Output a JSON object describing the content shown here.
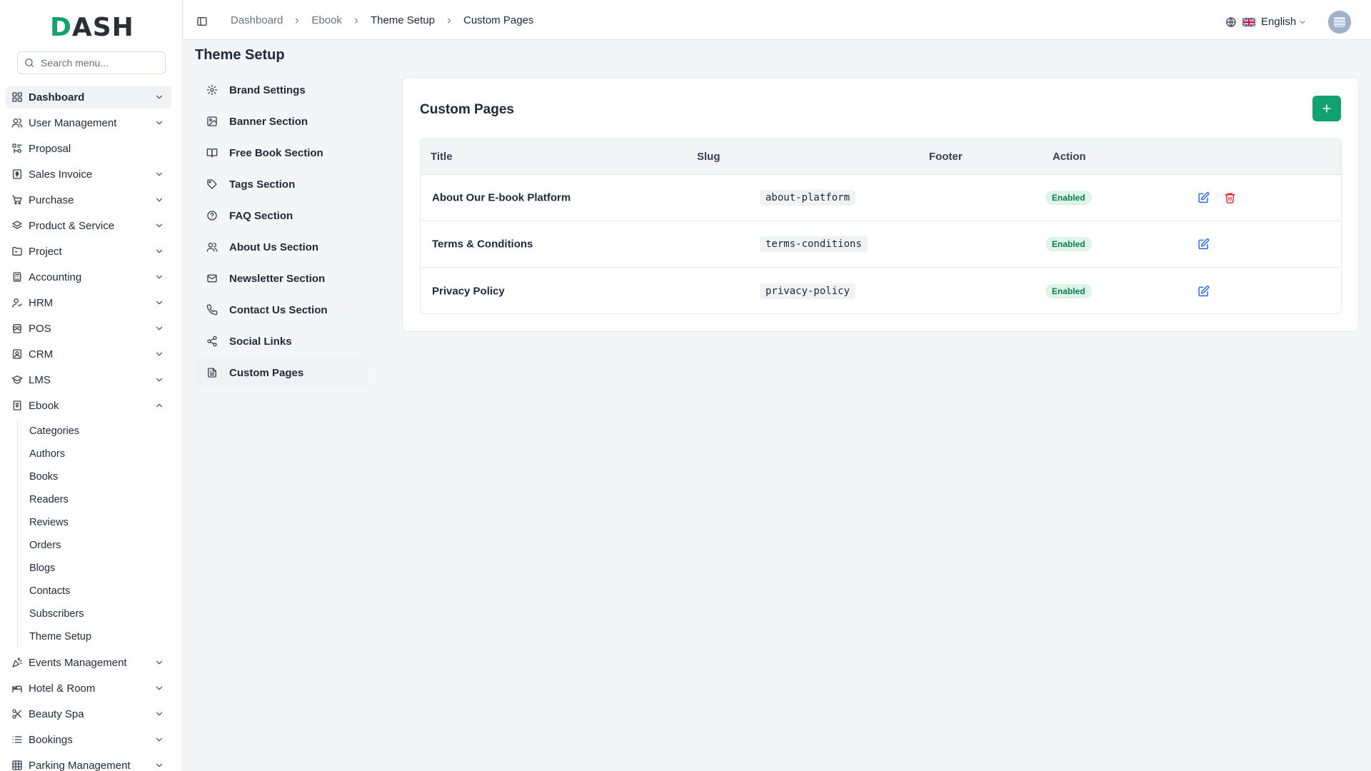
{
  "sidebar": {
    "logo_text": "DASH",
    "search_placeholder": "Search menu...",
    "items": [
      {
        "label": "Dashboard",
        "icon": "grid-icon",
        "expandable": true,
        "active": true
      },
      {
        "label": "User Management",
        "icon": "users-icon",
        "expandable": true
      },
      {
        "label": "Proposal",
        "icon": "proposal-icon",
        "expandable": false
      },
      {
        "label": "Sales Invoice",
        "icon": "invoice-icon",
        "expandable": true
      },
      {
        "label": "Purchase",
        "icon": "cart-icon",
        "expandable": true
      },
      {
        "label": "Product & Service",
        "icon": "layers-icon",
        "expandable": true
      },
      {
        "label": "Project",
        "icon": "folder-icon",
        "expandable": true
      },
      {
        "label": "Accounting",
        "icon": "calculator-icon",
        "expandable": true
      },
      {
        "label": "HRM",
        "icon": "hrm-icon",
        "expandable": true
      },
      {
        "label": "POS",
        "icon": "store-icon",
        "expandable": true
      },
      {
        "label": "CRM",
        "icon": "contact-card-icon",
        "expandable": true
      },
      {
        "label": "LMS",
        "icon": "graduation-cap-icon",
        "expandable": true
      },
      {
        "label": "Ebook",
        "icon": "book-icon",
        "expandable": true,
        "expanded": true
      }
    ],
    "ebook_children": [
      "Categories",
      "Authors",
      "Books",
      "Readers",
      "Reviews",
      "Orders",
      "Blogs",
      "Contacts",
      "Subscribers",
      "Theme Setup"
    ],
    "items_after": [
      {
        "label": "Events Management",
        "icon": "party-icon",
        "expandable": true
      },
      {
        "label": "Hotel & Room",
        "icon": "bed-icon",
        "expandable": true
      },
      {
        "label": "Beauty Spa",
        "icon": "scissors-icon",
        "expandable": true
      },
      {
        "label": "Bookings",
        "icon": "list-icon",
        "expandable": true
      },
      {
        "label": "Parking Management",
        "icon": "parking-grid-icon",
        "expandable": true
      }
    ]
  },
  "header": {
    "breadcrumb": [
      "Dashboard",
      "Ebook",
      "Theme Setup",
      "Custom Pages"
    ],
    "language": "English"
  },
  "page": {
    "title": "Theme Setup",
    "setup_nav": [
      {
        "label": "Brand Settings",
        "icon": "gear-icon"
      },
      {
        "label": "Banner Section",
        "icon": "image-icon"
      },
      {
        "label": "Free Book Section",
        "icon": "open-book-icon"
      },
      {
        "label": "Tags Section",
        "icon": "tag-icon"
      },
      {
        "label": "FAQ Section",
        "icon": "help-circle-icon"
      },
      {
        "label": "About Us Section",
        "icon": "users-icon"
      },
      {
        "label": "Newsletter Section",
        "icon": "mail-icon"
      },
      {
        "label": "Contact Us Section",
        "icon": "phone-icon"
      },
      {
        "label": "Social Links",
        "icon": "share-icon"
      },
      {
        "label": "Custom Pages",
        "icon": "file-text-icon",
        "active": true
      }
    ]
  },
  "card": {
    "title": "Custom Pages",
    "add_icon": "plus-icon",
    "columns": [
      "Title",
      "Slug",
      "Footer",
      "Action"
    ],
    "rows": [
      {
        "title": "About Our E-book Platform",
        "slug": "about-platform",
        "footer": "Enabled",
        "deletable": true
      },
      {
        "title": "Terms & Conditions",
        "slug": "terms-conditions",
        "footer": "Enabled",
        "deletable": false
      },
      {
        "title": "Privacy Policy",
        "slug": "privacy-policy",
        "footer": "Enabled",
        "deletable": false
      }
    ]
  },
  "colors": {
    "brand": "#10a36f",
    "badge_bg": "#dcf5e8",
    "badge_text": "#0f7a4e",
    "edit": "#2563eb",
    "delete": "#dc2626"
  }
}
